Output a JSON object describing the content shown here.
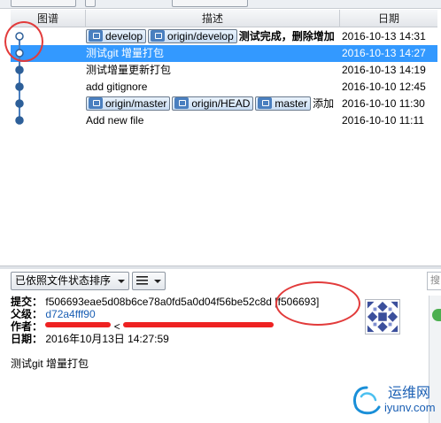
{
  "header": {
    "graph_label": "图谱",
    "description_label": "描述",
    "date_label": "日期"
  },
  "commits": [
    {
      "tags": [
        "develop",
        "origin/develop"
      ],
      "message": "测试完成，删除增加",
      "message_bold": true,
      "date": "2016-10-13 14:31",
      "selected": false
    },
    {
      "tags": [],
      "message": "测试git 增量打包",
      "message_bold": false,
      "date": "2016-10-13 14:27",
      "selected": true
    },
    {
      "tags": [],
      "message": "测试增量更新打包",
      "message_bold": false,
      "date": "2016-10-13 14:19",
      "selected": false
    },
    {
      "tags": [],
      "message": "add gitignore",
      "message_bold": false,
      "date": "2016-10-10 12:45",
      "selected": false
    },
    {
      "tags": [
        "origin/master",
        "origin/HEAD",
        "master"
      ],
      "message": "添加",
      "message_bold": false,
      "date": "2016-10-10 11:30",
      "selected": false
    },
    {
      "tags": [],
      "message": "Add new file",
      "message_bold": false,
      "date": "2016-10-10 11:11",
      "selected": false
    }
  ],
  "toolbar": {
    "sort_label": "已依照文件状态排序",
    "view_icon": "list-icon",
    "search_placeholder": "搜"
  },
  "details": {
    "commit_label": "提交：",
    "commit_hash": "f506693eae5d08b6ce78a0fd5a0d04f56be52c8d",
    "commit_short": "[f506693]",
    "parent_label": "父级：",
    "parent_hash": "d72a4fff90",
    "author_label": "作者：",
    "author_visible": "<",
    "date_label": "日期：",
    "date_value": "2016年10月13日 14:27:59",
    "message": "测试git 增量打包"
  },
  "watermark": {
    "text_cn": "运维网",
    "text_en": "iyunv.com"
  },
  "colors": {
    "selection": "#3399ff",
    "graph_line": "#4a7fbf",
    "annotation": "#e23b3b",
    "link": "#1a5fb4"
  }
}
